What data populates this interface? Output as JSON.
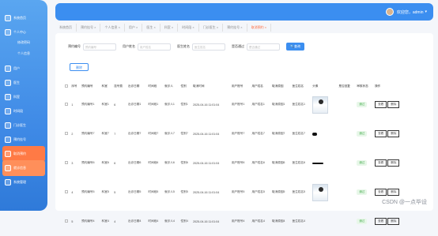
{
  "sidebar": {
    "items": [
      {
        "label": "系统首页",
        "type": "main"
      },
      {
        "label": "个人中心",
        "type": "main"
      },
      {
        "label": "修改密码",
        "type": "sub"
      },
      {
        "label": "个人信息",
        "type": "sub"
      },
      {
        "label": "用户",
        "type": "main"
      },
      {
        "label": "医生",
        "type": "main"
      },
      {
        "label": "科室",
        "type": "main"
      },
      {
        "label": "时间段",
        "type": "main"
      },
      {
        "label": "门诊医生",
        "type": "main"
      },
      {
        "label": "预约挂号",
        "type": "main"
      },
      {
        "label": "取消预约",
        "type": "main",
        "active": "active"
      },
      {
        "label": "就诊信息",
        "type": "main",
        "active": "active2"
      },
      {
        "label": "系统管理",
        "type": "main"
      }
    ]
  },
  "header": {
    "welcome": "欢迎您，admin",
    "dropdown": "▾"
  },
  "tabs": [
    {
      "label": "系统首页"
    },
    {
      "label": "预约挂号 ×"
    },
    {
      "label": "个人信息 ×"
    },
    {
      "label": "用户 ×"
    },
    {
      "label": "医生 ×"
    },
    {
      "label": "科室 ×"
    },
    {
      "label": "时间段 ×"
    },
    {
      "label": "门诊医生 ×"
    },
    {
      "label": "预约挂号 ×"
    },
    {
      "label": "取消预约 ×",
      "on": true
    }
  ],
  "search": {
    "f1_label": "预约编号",
    "f1_ph": "预约编号",
    "f2_label": "用户姓名",
    "f2_ph": "用户姓名",
    "f3_label": "医生姓名",
    "f3_ph": "医生姓名",
    "f4_label": "是否通过",
    "f4_ph": "是否通过",
    "button": "查询"
  },
  "delete_button": "删除",
  "table": {
    "headers": [
      "",
      "序号",
      "预约编号",
      "科室",
      "挂号费",
      "出诊日期",
      "时间段",
      "就诊人",
      "性别",
      "取消时间",
      "用户账号",
      "用户姓名",
      "取消原因",
      "医生姓名",
      "头像",
      "",
      "是否回复",
      "审核状态",
      "操作"
    ],
    "rows": [
      {
        "no": "1",
        "code": "预约编号1",
        "dept": "科室1",
        "fee": "6",
        "date": "出诊日期1",
        "slot": "时间段1",
        "patient": "就诊人1",
        "sex": "性别1",
        "time": "2025-04-16 11:01:04",
        "account": "用户账号1",
        "uname": "用户姓名1",
        "reason": "取消原因1",
        "doctor": "医生姓名1",
        "avatar": "photo",
        "reply": "",
        "status": "通过",
        "view": "查看",
        "del": "删除"
      },
      {
        "no": "2",
        "code": "预约编号7",
        "dept": "科室7",
        "fee": "7",
        "date": "出诊日期7",
        "slot": "时间段7",
        "patient": "就诊人7",
        "sex": "性别7",
        "time": "2025-04-16 11:01:04",
        "account": "用户账号7",
        "uname": "用户姓名7",
        "reason": "取消原因7",
        "doctor": "医生姓名7",
        "avatar": "dot",
        "reply": "",
        "status": "通过",
        "view": "查看",
        "del": "删除"
      },
      {
        "no": "3",
        "code": "预约编号6",
        "dept": "科室6",
        "fee": "6",
        "date": "出诊日期6",
        "slot": "时间段6",
        "patient": "就诊人6",
        "sex": "性别6",
        "time": "2025-04-16 11:01:04",
        "account": "用户账号6",
        "uname": "用户姓名6",
        "reason": "取消原因6",
        "doctor": "医生姓名6",
        "avatar": "bar",
        "reply": "",
        "status": "通过",
        "view": "查看",
        "del": "删除"
      },
      {
        "no": "4",
        "code": "预约编号5",
        "dept": "科室5",
        "fee": "5",
        "date": "出诊日期5",
        "slot": "时间段5",
        "patient": "就诊人5",
        "sex": "性别5",
        "time": "2025-04-16 11:01:04",
        "account": "用户账号5",
        "uname": "用户姓名5",
        "reason": "取消原因5",
        "doctor": "医生姓名5",
        "avatar": "photo",
        "reply": "",
        "status": "通过",
        "view": "查看",
        "del": "删除"
      },
      {
        "no": "5",
        "code": "预约编号4",
        "dept": "科室4",
        "fee": "4",
        "date": "出诊日期4",
        "slot": "时间段4",
        "patient": "就诊人4",
        "sex": "性别4",
        "time": "2025-04-16 11:01:04",
        "account": "用户账号4",
        "uname": "用户姓名4",
        "reason": "取消原因4",
        "doctor": "医生姓名4",
        "avatar": "",
        "reply": "",
        "status": "通过",
        "view": "查看",
        "del": "删除"
      }
    ]
  },
  "watermark": "CSDN @一点毕设",
  "colors": {
    "primary": "#3b8ef0",
    "active": "#ff7a45",
    "success": "#52b35a"
  }
}
